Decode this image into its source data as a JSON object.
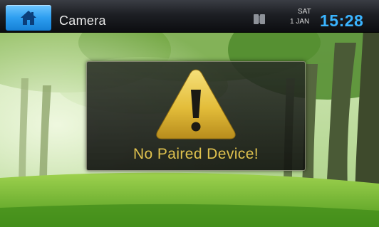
{
  "statusbar": {
    "title": "Camera",
    "home_icon": "home-icon",
    "device_icon": "phone-book-icon",
    "day": "SAT",
    "date": "1 JAN",
    "time": "15:28"
  },
  "dialog": {
    "icon": "warning-icon",
    "message": "No Paired Device!"
  },
  "colors": {
    "accent_blue": "#2d9ef0",
    "clock_blue": "#3ab4ff",
    "warning_gold": "#e0c24e"
  }
}
